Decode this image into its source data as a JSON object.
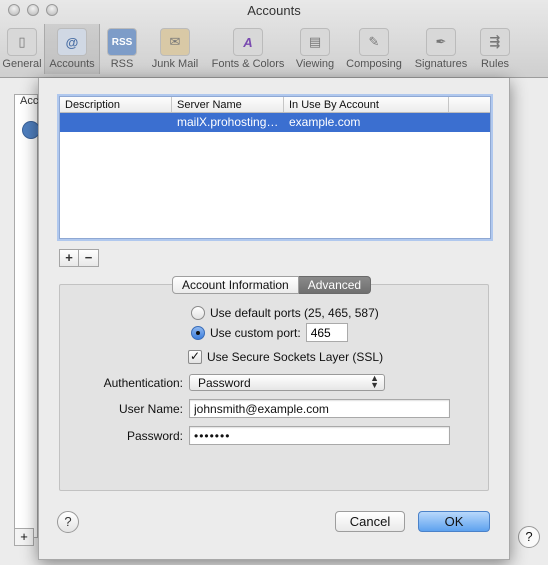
{
  "window": {
    "title": "Accounts"
  },
  "toolbar": {
    "items": [
      {
        "label": "General",
        "icon": "switch-icon"
      },
      {
        "label": "Accounts",
        "icon": "at-sign-icon"
      },
      {
        "label": "RSS",
        "icon": "rss-icon"
      },
      {
        "label": "Junk Mail",
        "icon": "junk-bag-icon"
      },
      {
        "label": "Fonts & Colors",
        "icon": "fonts-icon"
      },
      {
        "label": "Viewing",
        "icon": "viewing-icon"
      },
      {
        "label": "Composing",
        "icon": "composing-icon"
      },
      {
        "label": "Signatures",
        "icon": "signature-icon"
      },
      {
        "label": "Rules",
        "icon": "rules-icon"
      }
    ],
    "active": "Accounts"
  },
  "background": {
    "list_header": "Acc",
    "plus_label": "+",
    "help_label": "?"
  },
  "server_table": {
    "columns": [
      "Description",
      "Server Name",
      "In Use By Account"
    ],
    "rows": [
      {
        "description": "",
        "server_name": "mailX.prohosting…",
        "account": "example.com"
      }
    ]
  },
  "list_buttons": {
    "add": "+",
    "remove": "−"
  },
  "tabs": [
    {
      "label": "Account Information",
      "selected": false
    },
    {
      "label": "Advanced",
      "selected": true
    }
  ],
  "advanced": {
    "default_ports_label": "Use default ports (25, 465, 587)",
    "custom_port_label": "Use custom port:",
    "custom_port_value": "465",
    "ssl_label": "Use Secure Sockets Layer (SSL)",
    "ssl_checked": true,
    "auth_label": "Authentication:",
    "auth_value": "Password",
    "username_label": "User Name:",
    "username_value": "johnsmith@example.com",
    "password_label": "Password:",
    "password_value": "•••••••"
  },
  "buttons": {
    "help": "?",
    "cancel": "Cancel",
    "ok": "OK"
  },
  "colors": {
    "selection": "#3b6fd0",
    "default_button": "#5ea2ef"
  }
}
